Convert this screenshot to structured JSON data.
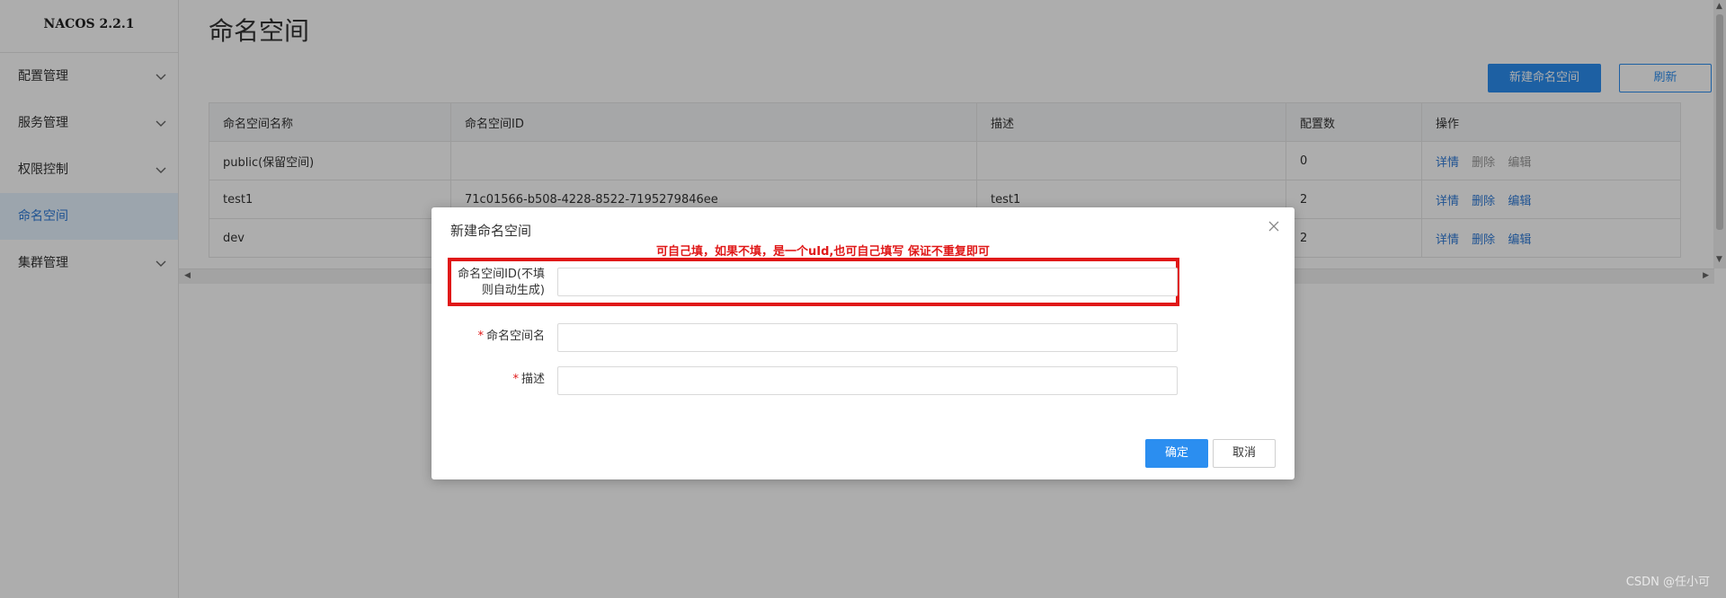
{
  "sidebar": {
    "brand": "NACOS 2.2.1",
    "items": [
      {
        "label": "配置管理"
      },
      {
        "label": "服务管理"
      },
      {
        "label": "权限控制"
      },
      {
        "label": "命名空间"
      },
      {
        "label": "集群管理"
      }
    ]
  },
  "main": {
    "title": "命名空间",
    "new_button": "新建命名空间",
    "refresh_button": "刷新",
    "table": {
      "columns": [
        "命名空间名称",
        "命名空间ID",
        "描述",
        "配置数",
        "操作"
      ],
      "rows": [
        {
          "name": "public(保留空间)",
          "id": "",
          "desc": "",
          "count": "0",
          "ops": [
            "详情",
            "删除",
            "编辑"
          ]
        },
        {
          "name": "test1",
          "id": "71c01566-b508-4228-8522-7195279846ee",
          "desc": "test1",
          "count": "2",
          "ops": [
            "详情",
            "删除",
            "编辑"
          ]
        },
        {
          "name": "dev",
          "id": "",
          "desc": "",
          "count": "2",
          "ops": [
            "详情",
            "删除",
            "编辑"
          ]
        }
      ]
    }
  },
  "dialog": {
    "title": "新建命名空间",
    "annotation": "可自己填，如果不填，是一个uId,也可自己填写 保证不重复即可",
    "fields": {
      "ns_id_label_line1": "命名空间ID(不填",
      "ns_id_label_line2": "则自动生成)",
      "ns_name_label": "命名空间名",
      "desc_label": "描述",
      "required_mark": "*"
    },
    "confirm": "确定",
    "cancel": "取消"
  },
  "watermark": "CSDN @任小可",
  "colors": {
    "primary": "#2b8ef0",
    "highlight": "#e01818",
    "active_nav_bg": "#e6f3ff"
  }
}
